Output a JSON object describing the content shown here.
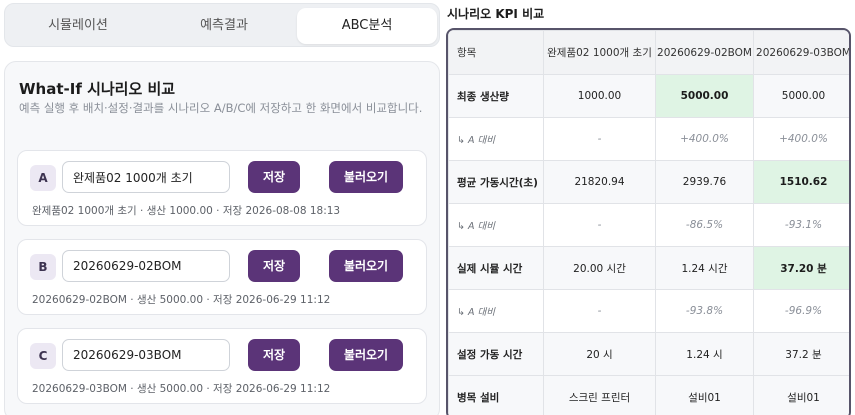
{
  "tabs": [
    "시뮬레이션",
    "예측결과",
    "ABC분석"
  ],
  "panel": {
    "title": "What-If 시나리오 비교",
    "description": "예측 실행 후 배치·설정·결과를 시나리오 A/B/C에 저장하고 한 화면에서 비교합니다."
  },
  "scenarios": [
    {
      "letter": "A",
      "name": "완제품02 1000개 초기",
      "save_label": "저장",
      "load_label": "불러오기",
      "meta": "완제품02 1000개 초기 · 생산 1000.00 · 저장 2026-08-08 18:13"
    },
    {
      "letter": "B",
      "name": "20260629-02BOM",
      "save_label": "저장",
      "load_label": "불러오기",
      "meta": "20260629-02BOM · 생산 5000.00 · 저장 2026-06-29 11:12"
    },
    {
      "letter": "C",
      "name": "20260629-03BOM",
      "save_label": "저장",
      "load_label": "불러오기",
      "meta": "20260629-03BOM · 생산 5000.00 · 저장 2026-06-29 11:12"
    }
  ],
  "kpi": {
    "title": "시나리오 KPI 비교",
    "headers": [
      "항목",
      "완제품02 1000개 초기",
      "20260629-02BOM",
      "20260629-03BOM"
    ],
    "rows": [
      {
        "label": "최종 생산량",
        "values": [
          "1000.00",
          "5000.00",
          "5000.00"
        ]
      },
      {
        "label": "↳ A 대비",
        "values": [
          "-",
          "+400.0%",
          "+400.0%"
        ]
      },
      {
        "label": "평균 가동시간(초)",
        "values": [
          "21820.94",
          "2939.76",
          "1510.62"
        ]
      },
      {
        "label": "↳ A 대비",
        "values": [
          "-",
          "-86.5%",
          "-93.1%"
        ]
      },
      {
        "label": "실제 시뮬 시간",
        "values": [
          "20.00 시간",
          "1.24 시간",
          "37.20 분"
        ]
      },
      {
        "label": "↳ A 대비",
        "values": [
          "-",
          "-93.8%",
          "-96.9%"
        ]
      },
      {
        "label": "설정 가동 시간",
        "values": [
          "20 시",
          "1.24 시",
          "37.2 분"
        ]
      },
      {
        "label": "병목 설비",
        "values": [
          "스크린 프린터",
          "설비01",
          "설비01"
        ]
      }
    ],
    "best_color": "#dff4e4"
  },
  "colors": {
    "accent": "#5b3478",
    "table_border": "#57546a"
  }
}
